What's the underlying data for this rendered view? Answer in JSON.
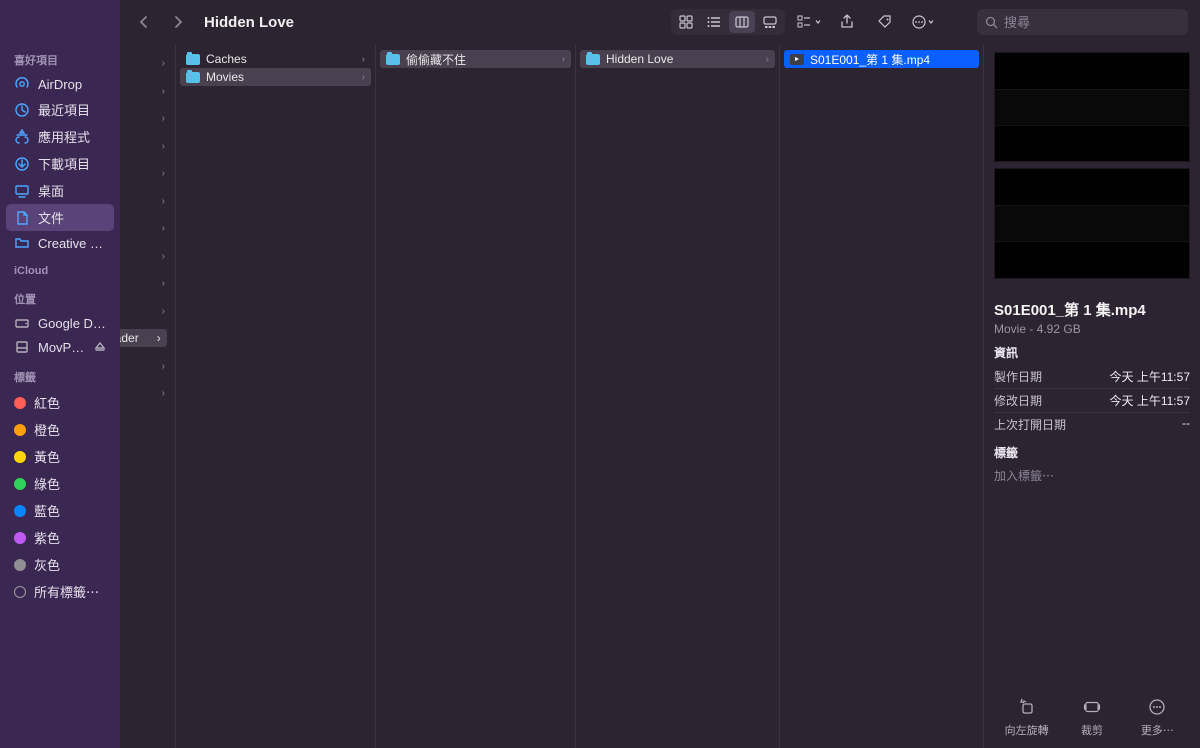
{
  "window_title": "Hidden Love",
  "search_placeholder": "搜尋",
  "sidebar": {
    "favorites_title": "喜好項目",
    "favorites": [
      {
        "id": "airdrop",
        "label": "AirDrop",
        "icon": "airdrop"
      },
      {
        "id": "recent",
        "label": "最近項目",
        "icon": "clock"
      },
      {
        "id": "apps",
        "label": "應用程式",
        "icon": "apps"
      },
      {
        "id": "downloads",
        "label": "下載項目",
        "icon": "download"
      },
      {
        "id": "desktop",
        "label": "桌面",
        "icon": "desktop"
      },
      {
        "id": "documents",
        "label": "文件",
        "icon": "documents",
        "active": true
      },
      {
        "id": "cc",
        "label": "Creative Clo…",
        "icon": "folder"
      }
    ],
    "icloud_title": "iCloud",
    "locations_title": "位置",
    "locations": [
      {
        "id": "gdrive",
        "label": "Google Drive",
        "icon": "drive"
      },
      {
        "id": "mov",
        "label": "MovPilot …",
        "icon": "disk",
        "eject": true
      }
    ],
    "tags_title": "標籤",
    "tags": [
      {
        "color": "red",
        "label": "紅色"
      },
      {
        "color": "orange",
        "label": "橙色"
      },
      {
        "color": "yellow",
        "label": "黃色"
      },
      {
        "color": "green",
        "label": "綠色"
      },
      {
        "color": "blue",
        "label": "藍色"
      },
      {
        "color": "purple",
        "label": "紫色"
      },
      {
        "color": "gray",
        "label": "灰色"
      }
    ],
    "all_tags": "所有標籤⋯"
  },
  "columns": {
    "pre": {
      "ghost_items": [
        "",
        "",
        "",
        "",
        "",
        "",
        "",
        "",
        "",
        "",
        ""
      ],
      "selected_label": "wnloader",
      "selected_index": 10,
      "trailing": [
        ""
      ]
    },
    "a": [
      {
        "name": "Caches",
        "type": "folder"
      },
      {
        "name": "Movies",
        "type": "folder",
        "selected": true
      }
    ],
    "b": [
      {
        "name": "偷偷藏不住",
        "type": "folder",
        "selected": true
      }
    ],
    "c": [
      {
        "name": "Hidden Love",
        "type": "folder",
        "selected": true
      }
    ],
    "d": [
      {
        "name": "S01E001_第 1 集.mp4",
        "type": "video",
        "selected": true
      }
    ]
  },
  "preview": {
    "filename": "S01E001_第 1 集.mp4",
    "subtitle": "Movie - 4.92 GB",
    "info_heading": "資訊",
    "info": [
      {
        "label": "製作日期",
        "value": "今天 上午11:57"
      },
      {
        "label": "修改日期",
        "value": "今天 上午11:57"
      },
      {
        "label": "上次打開日期",
        "value": "--"
      }
    ],
    "tags_heading": "標籤",
    "add_tag_placeholder": "加入標籤⋯",
    "footer": [
      {
        "id": "rotate",
        "label": "向左旋轉"
      },
      {
        "id": "trim",
        "label": "裁剪"
      },
      {
        "id": "more",
        "label": "更多⋯"
      }
    ]
  }
}
